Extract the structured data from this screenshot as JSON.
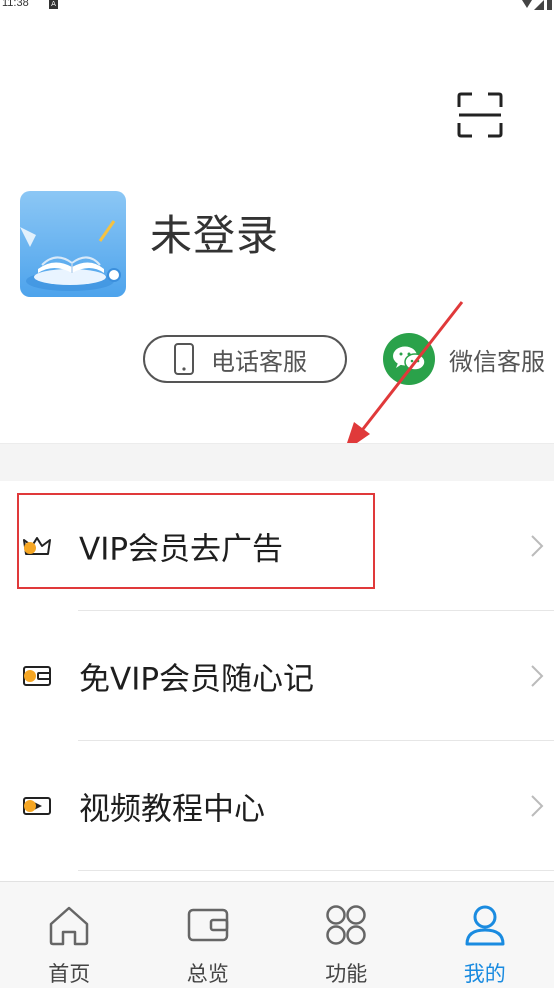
{
  "status_bar": {
    "time": "11:38",
    "notification_letter": "A"
  },
  "header": {
    "scan_icon": "scan-icon"
  },
  "profile": {
    "title": "未登录",
    "avatar_icon": "book-avatar-icon"
  },
  "support": {
    "phone_label": "电话客服",
    "phone_icon": "phone-icon",
    "wechat_label": "微信客服",
    "wechat_icon": "wechat-icon"
  },
  "menu": {
    "items": [
      {
        "label": "VIP会员去广告",
        "icon": "crown-icon"
      },
      {
        "label": "免VIP会员随心记",
        "icon": "wallet-icon"
      },
      {
        "label": "视频教程中心",
        "icon": "video-icon"
      }
    ]
  },
  "nav": {
    "items": [
      {
        "label": "首页",
        "icon": "home-icon",
        "active": false
      },
      {
        "label": "总览",
        "icon": "wallet-icon",
        "active": false
      },
      {
        "label": "功能",
        "icon": "grid-icon",
        "active": false
      },
      {
        "label": "我的",
        "icon": "user-icon",
        "active": true
      }
    ]
  },
  "colors": {
    "accent": "#1a8be0",
    "wechat_green": "#2aa24a",
    "annotation_red": "#e0393a",
    "icon_orange": "#f5a623"
  }
}
